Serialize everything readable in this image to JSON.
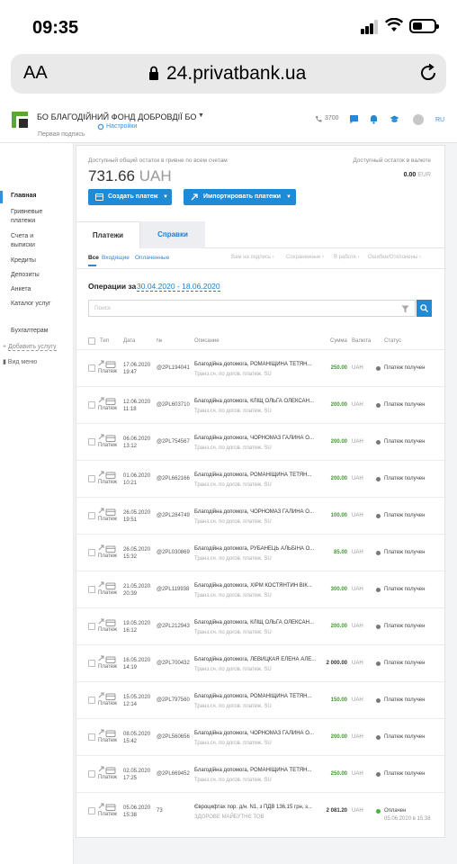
{
  "status_bar": {
    "time": "09:35"
  },
  "browser": {
    "text_size": "AA",
    "url": "24.privatbank.ua"
  },
  "header": {
    "org_name": "БО БЛАГОДІЙНИЙ ФОНД ДОБРОВДІЇ БО",
    "settings": "Настройки",
    "first_signature": "Первая подпись",
    "phone": "3700",
    "lang": "RU"
  },
  "sidebar": {
    "items": [
      "Главная",
      "Гривневые платежи",
      "Счета и выписки",
      "Кредиты",
      "Депозиты",
      "Анкета",
      "Каталог услуг",
      "Бухгалтерам",
      "Добавить услугу",
      "Вид меню"
    ]
  },
  "balance": {
    "label": "Доступный общий остаток в гривне по всем счетам",
    "amount": "731.66",
    "currency": "UAH",
    "fx_label": "Доступный остаток в валюте",
    "fx_amount": "0.00",
    "fx_currency": "EUR"
  },
  "buttons": {
    "create": "Создать платеж",
    "import": "Импортировать платежи"
  },
  "tabs": [
    "Платежи",
    "Справки"
  ],
  "filters": {
    "all": "Все",
    "incoming": "Входящие",
    "paid": "Оплаченные",
    "steps": [
      "Вам на подпись",
      "Сохраненные",
      "В работе",
      "Ошибки/Отклонены"
    ]
  },
  "operations": {
    "label": "Операции за",
    "period": "30.04.2020 - 18.06.2020"
  },
  "search": {
    "placeholder": "Поиск"
  },
  "columns": [
    "Тип",
    "Дата",
    "№",
    "Описание",
    "Сумма",
    "Валюта",
    "Статус"
  ],
  "rows": [
    {
      "type": "Платеж",
      "date": "17.06.2020",
      "time": "19:47",
      "num": "@2PL194041",
      "desc": "Благодійна допомога, РОМАНІЩИНА ТЕТЯН...",
      "sub": "Транз.сч. по догов. платеж. SU",
      "amount": "250.00",
      "currency": "UAH",
      "status": "Платеж получен",
      "status2": ""
    },
    {
      "type": "Платеж",
      "date": "12.06.2020",
      "time": "11:18",
      "num": "@2PL603710",
      "desc": "Благодійна допомога, КЛІЩ ОЛЬГА ОЛЕКСАН...",
      "sub": "Транз.сч. по догов. платеж. SU",
      "amount": "200.00",
      "currency": "UAH",
      "status": "Платеж получен",
      "status2": ""
    },
    {
      "type": "Платеж",
      "date": "06.06.2020",
      "time": "13:12",
      "num": "@2PL754567",
      "desc": "Благодійна допомога, ЧОРНОМАЗ ГАЛИНА О...",
      "sub": "Транз.сч. по догов. платеж. SU",
      "amount": "200.00",
      "currency": "UAH",
      "status": "Платеж получен",
      "status2": ""
    },
    {
      "type": "Платеж",
      "date": "01.06.2020",
      "time": "10:21",
      "num": "@2PL662166",
      "desc": "Благодійна допомога, РОМАНІЩИНА ТЕТЯН...",
      "sub": "Транз.сч. по догов. платеж. SU",
      "amount": "200.00",
      "currency": "UAH",
      "status": "Платеж получен",
      "status2": ""
    },
    {
      "type": "Платеж",
      "date": "26.05.2020",
      "time": "19:51",
      "num": "@2PL284749",
      "desc": "Благодійна допомога, ЧОРНОМАЗ ГАЛИНА О...",
      "sub": "Транз.сч. по догов. платеж. SU",
      "amount": "100.00",
      "currency": "UAH",
      "status": "Платеж получен",
      "status2": ""
    },
    {
      "type": "Платеж",
      "date": "26.05.2020",
      "time": "15:32",
      "num": "@2PL030869",
      "desc": "Благодійна допомога, РУБАНЕЦЬ АЛЬБІНА О...",
      "sub": "Транз.сч. по догов. платеж. SU",
      "amount": "85.00",
      "currency": "UAH",
      "status": "Платеж получен",
      "status2": ""
    },
    {
      "type": "Платеж",
      "date": "21.05.2020",
      "time": "20:39",
      "num": "@2PL119938",
      "desc": "Благодійна допомога, ХІРМ КОСТЯНТИН ВІК...",
      "sub": "Транз.сч. по догов. платеж. SU",
      "amount": "300.00",
      "currency": "UAH",
      "status": "Платеж получен",
      "status2": ""
    },
    {
      "type": "Платеж",
      "date": "19.05.2020",
      "time": "16:12",
      "num": "@2PL212943",
      "desc": "Благодійна допомога, КЛІЩ ОЛЬГА ОЛЕКСАН...",
      "sub": "Транз.сч. по догов. платеж. SU",
      "amount": "200.00",
      "currency": "UAH",
      "status": "Платеж получен",
      "status2": ""
    },
    {
      "type": "Платеж",
      "date": "16.05.2020",
      "time": "14:19",
      "num": "@2PL700432",
      "desc": "Благодійна допомога, ЛЕВИЦКАЯ ЕЛЕНА АЛЕ...",
      "sub": "Транз.сч. по догов. платеж. SU",
      "amount": "2 000.00",
      "currency": "UAH",
      "status": "Платеж получен",
      "status2": ""
    },
    {
      "type": "Платеж",
      "date": "15.05.2020",
      "time": "12:14",
      "num": "@2PL797560",
      "desc": "Благодійна допомога, РОМАНІЩИНА ТЕТЯН...",
      "sub": "Транз.сч. по догов. платеж. SU",
      "amount": "150.00",
      "currency": "UAH",
      "status": "Платеж получен",
      "status2": ""
    },
    {
      "type": "Платеж",
      "date": "08.05.2020",
      "time": "15:42",
      "num": "@2PL560656",
      "desc": "Благодійна допомога, ЧОРНОМАЗ ГАЛИНА О...",
      "sub": "Транз.сч. по догов. платеж. SU",
      "amount": "200.00",
      "currency": "UAH",
      "status": "Платеж получен",
      "status2": ""
    },
    {
      "type": "Платеж",
      "date": "02.05.2020",
      "time": "17:25",
      "num": "@2PL669452",
      "desc": "Благодійна допомога, РОМАНІЩИНА ТЕТЯН...",
      "sub": "Транз.сч. по догов. платеж. SU",
      "amount": "250.00",
      "currency": "UAH",
      "status": "Платеж получен",
      "status2": ""
    },
    {
      "type": "Платеж",
      "date": "05.06.2020",
      "time": "15:38",
      "num": "73",
      "desc": "Євроцифтах пор. д/н. N1, з ПДВ 136,15 грн, з...",
      "sub": "ЗДОРОВЕ МАЙБУТНЄ ТОВ",
      "amount": "2 081.20",
      "currency": "UAH",
      "status": "Оплачен",
      "status2": "05.06.2020 в 15:38"
    }
  ],
  "colors": {
    "accent": "#1f8ad6",
    "amount_green": "#3e9b2e",
    "logo_green": "#5aa731"
  }
}
